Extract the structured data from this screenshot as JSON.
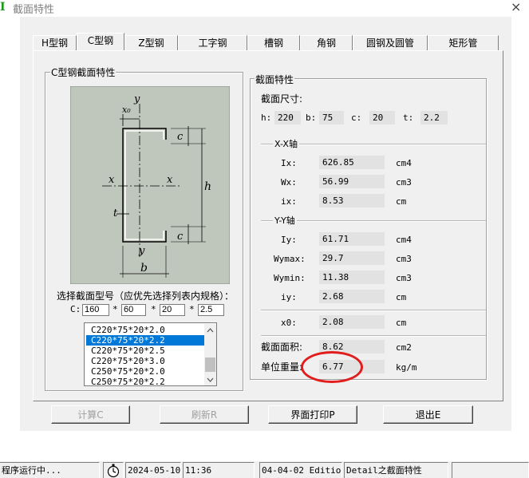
{
  "window": {
    "title": "截面特性",
    "icon_letter": "I",
    "close_glyph": "×"
  },
  "tabs": [
    "H型钢",
    "C型钢",
    "Z型钢",
    "工字钢",
    "槽钢",
    "角钢",
    "圆钢及圆管",
    "矩形管"
  ],
  "active_tab": "C型钢",
  "left_group": {
    "title": "C型钢截面特性",
    "diagram_labels": {
      "y_top": "y",
      "x0": "x₀",
      "c_top": "c",
      "x_left": "x",
      "x_right": "x",
      "h": "h",
      "t": "t",
      "c_bottom": "c",
      "y_bottom": "y",
      "b": "b"
    },
    "select_label": "选择截面型号（应优先选择列表内规格）：",
    "c_label": "C:",
    "inputs": [
      "160",
      "60",
      "20",
      "2.5"
    ],
    "star": "*",
    "list": [
      "C220*75*20*2.0",
      "C220*75*20*2.2",
      "C220*75*20*2.5",
      "C220*75*20*3.0",
      "C250*75*20*2.0",
      "C250*75*20*2.2"
    ],
    "selected_index": 1
  },
  "right_group": {
    "title": "截面特性",
    "size_title": "截面尺寸:",
    "dims": [
      {
        "label": "h:",
        "value": "220"
      },
      {
        "label": "b:",
        "value": "75"
      },
      {
        "label": "c:",
        "value": "20"
      },
      {
        "label": "t:",
        "value": "2.2"
      }
    ],
    "xx_title": "X-X轴",
    "xx": [
      {
        "label": "Ix:",
        "value": "626.85",
        "unit": "cm4"
      },
      {
        "label": "Wx:",
        "value": "56.99",
        "unit": "cm3"
      },
      {
        "label": "ix:",
        "value": "8.53",
        "unit": "cm"
      }
    ],
    "yy_title": "Y-Y轴",
    "yy": [
      {
        "label": "Iy:",
        "value": "61.71",
        "unit": "cm4"
      },
      {
        "label": "Wymax:",
        "value": "29.7",
        "unit": "cm3"
      },
      {
        "label": "Wymin:",
        "value": "11.38",
        "unit": "cm3"
      },
      {
        "label": "iy:",
        "value": "2.68",
        "unit": "cm"
      }
    ],
    "x0": {
      "label": "x0:",
      "value": "2.08",
      "unit": "cm"
    },
    "area": {
      "label": "截面面积:",
      "value": "8.62",
      "unit": "cm2"
    },
    "weight": {
      "label": "单位重量:",
      "value": "6.77",
      "unit": "kg/m"
    }
  },
  "buttons": {
    "calc": "计算C",
    "refresh": "刷新R",
    "print": "界面打印P",
    "exit": "退出E"
  },
  "statusbar": {
    "running": "程序运行中...",
    "date": "2024-05-10",
    "time": "11:36",
    "edition": "04-04-02 Edition",
    "detail": "Detail之截面特性"
  },
  "colors": {
    "diagram_bg": "#bfc6bb",
    "selection": "#0078d7",
    "annotation": "#e11d1d"
  }
}
